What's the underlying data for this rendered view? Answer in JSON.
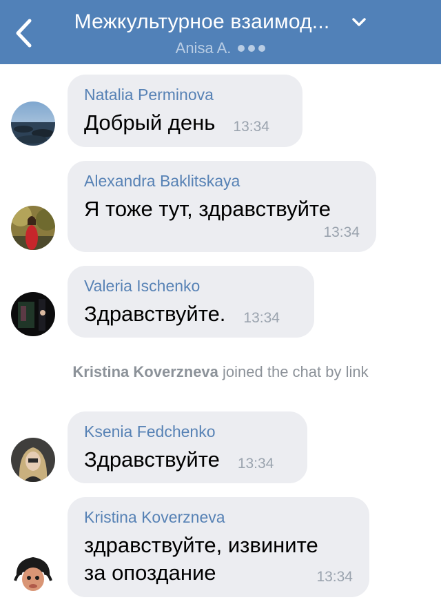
{
  "header": {
    "title": "Межкультурное взаимод...",
    "subtitle": "Anisa A."
  },
  "messages": [
    {
      "sender": "Natalia Perminova",
      "text": "Добрый день",
      "time": "13:34"
    },
    {
      "sender": "Alexandra Baklitskaya",
      "text": "Я тоже тут, здравствуйте",
      "time": "13:34"
    },
    {
      "sender": "Valeria Ischenko",
      "text": "Здравствуйте.",
      "time": "13:34"
    },
    {
      "sender": "Ksenia Fedchenko",
      "text": "Здравствуйте",
      "time": "13:34"
    },
    {
      "sender": "Kristina Koverzneva",
      "text_line1": "здравствуйте, извините",
      "text_line2": "за опоздание",
      "time": "13:34"
    }
  ],
  "service_message": {
    "name": "Kristina Koverzneva",
    "action": "joined the chat by link"
  },
  "colors": {
    "header_bg": "#5181b8",
    "bubble_bg": "#ecedf1",
    "sender_name": "#5782b5"
  }
}
